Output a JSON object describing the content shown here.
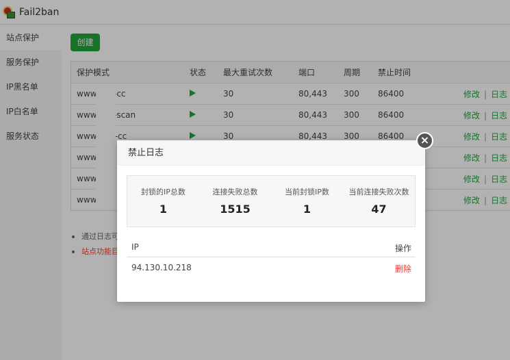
{
  "app": {
    "title": "Fail2ban"
  },
  "sidebar": {
    "items": [
      {
        "label": "站点保护"
      },
      {
        "label": "服务保护"
      },
      {
        "label": "IP黑名单"
      },
      {
        "label": "IP白名单"
      },
      {
        "label": "服务状态"
      }
    ]
  },
  "toolbar": {
    "create_label": "创建"
  },
  "table": {
    "headers": {
      "mode": "保护模式",
      "status": "状态",
      "retry": "最大重试次数",
      "port": "端口",
      "period": "周期",
      "ban": "禁止时间"
    },
    "rows": [
      {
        "mode": "www.       .cn-cc",
        "retry": "30",
        "port": "80,443",
        "period": "300",
        "ban": "86400"
      },
      {
        "mode": "www.       .cn-scan",
        "retry": "30",
        "port": "80,443",
        "period": "300",
        "ban": "86400"
      },
      {
        "mode": "www.       top-cc",
        "retry": "30",
        "port": "80,443",
        "period": "300",
        "ban": "86400"
      },
      {
        "mode": "www.",
        "retry": "",
        "port": "",
        "period": "",
        "ban": ""
      },
      {
        "mode": "www.",
        "retry": "",
        "port": "",
        "period": "",
        "ban": ""
      },
      {
        "mode": "www.",
        "retry": "",
        "port": "",
        "period": "",
        "ban": ""
      }
    ],
    "edit_label": "修改",
    "log_label": "日志"
  },
  "notes": [
    {
      "text": "通过日志可"
    },
    {
      "text": "站点功能目"
    }
  ],
  "modal": {
    "title": "禁止日志",
    "close_icon": "close-icon",
    "stats": [
      {
        "label": "封锁的IP总数",
        "value": "1"
      },
      {
        "label": "连接失败总数",
        "value": "1515"
      },
      {
        "label": "当前封锁IP数",
        "value": "1"
      },
      {
        "label": "当前连接失败次数",
        "value": "47"
      }
    ],
    "ip_table": {
      "col_ip": "IP",
      "col_action": "操作",
      "rows": [
        {
          "ip": "94.130.10.218",
          "action": "删除"
        }
      ]
    }
  },
  "colors": {
    "accent": "#20a53a",
    "danger": "#e33333"
  }
}
